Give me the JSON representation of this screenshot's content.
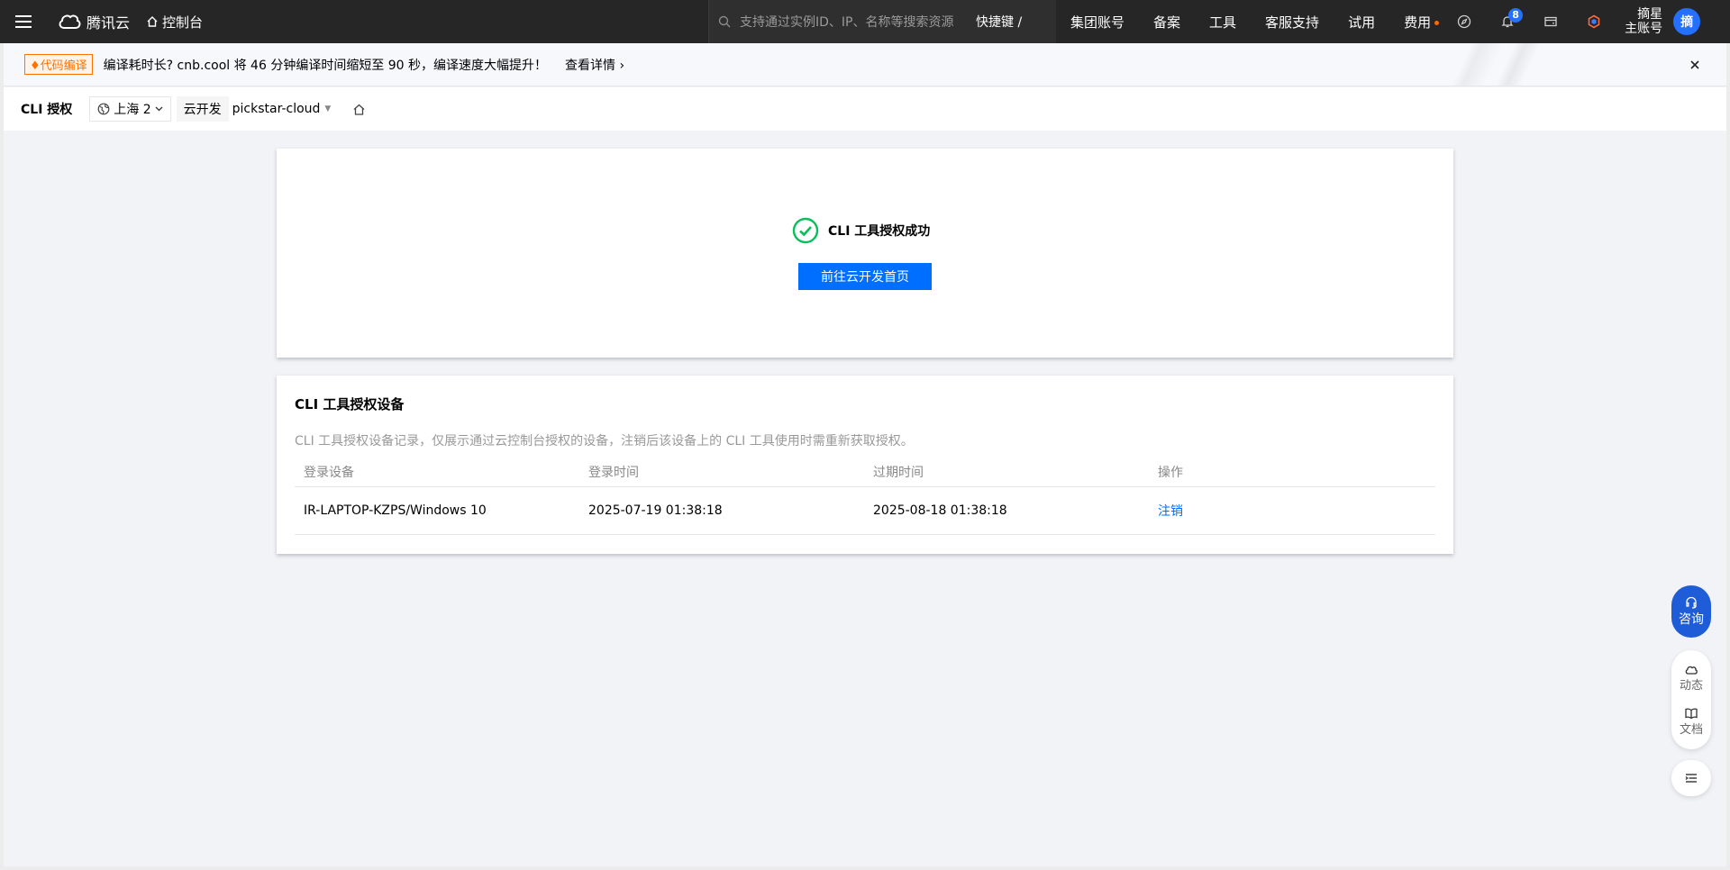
{
  "topbar": {
    "brand": "腾讯云",
    "console": "控制台",
    "search_placeholder": "支持通过实例ID、IP、名称等搜索资源",
    "shortcut": "快捷键 /",
    "links": [
      "集团账号",
      "备案",
      "工具",
      "客服支持",
      "试用",
      "费用"
    ],
    "notification_count": "8",
    "account_line1": "摘星",
    "account_line2": "主账号",
    "avatar": "摘"
  },
  "notice": {
    "tag": "♦代码编译",
    "text": "编译耗时长? cnb.cool 将 46 分钟编译时间缩短至 90 秒，编译速度大幅提升！",
    "link": "查看详情 ›"
  },
  "subbar": {
    "title": "CLI 授权",
    "region": "上海 2",
    "env_label": "云开发",
    "env_value": "pickstar-cloud"
  },
  "success": {
    "message": "CLI 工具授权成功",
    "button": "前往云开发首页"
  },
  "devices": {
    "title": "CLI 工具授权设备",
    "description": "CLI 工具授权设备记录，仅展示通过云控制台授权的设备，注销后该设备上的 CLI 工具使用时需重新获取授权。",
    "columns": [
      "登录设备",
      "登录时间",
      "过期时间",
      "操作"
    ],
    "rows": [
      {
        "device": "IR-LAPTOP-KZPS/Windows 10",
        "login_time": "2025-07-19 01:38:18",
        "expire_time": "2025-08-18 01:38:18",
        "action": "注销"
      }
    ]
  },
  "float": {
    "consult": "咨询",
    "dynamics": "动态",
    "docs": "文档"
  },
  "colors": {
    "primary": "#006eff",
    "success": "#0abf5b",
    "topbar": "#262626",
    "notice_tag": "#ff7200"
  }
}
